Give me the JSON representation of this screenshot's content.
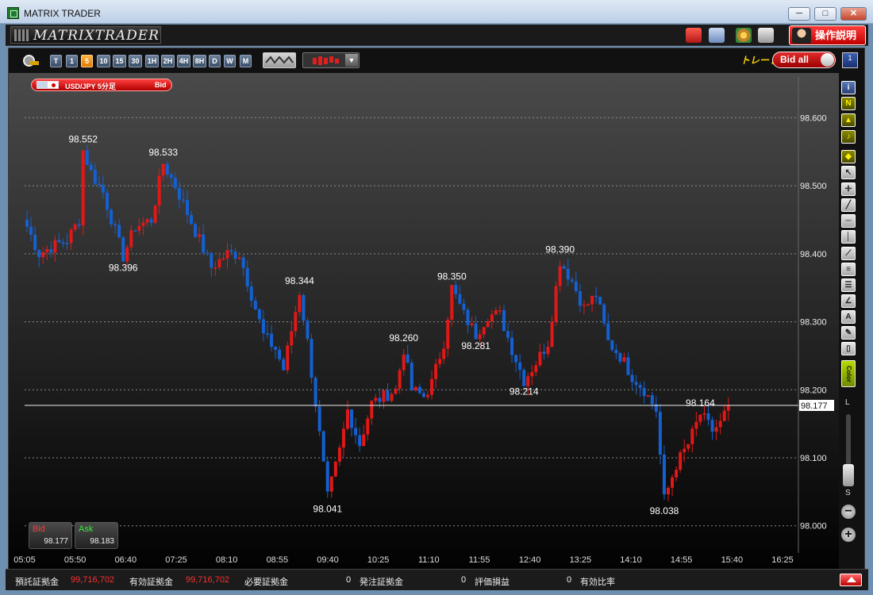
{
  "window": {
    "title": "MATRIX TRADER",
    "controls": {
      "minimize": "─",
      "maximize": "□",
      "close": "✕"
    }
  },
  "header": {
    "logo": "MATRIXTRADER",
    "help_button": "操作説明",
    "icons": [
      "briefcase-icon",
      "save-icon",
      "palette-icon",
      "print-icon"
    ]
  },
  "toolbar": {
    "timeframes": [
      "T",
      "1",
      "5",
      "10",
      "15",
      "30",
      "1H",
      "2H",
      "4H",
      "8H",
      "D",
      "W",
      "M"
    ],
    "active_timeframe": "5",
    "trade_label": "トレード",
    "bid_toggle_label": "Bid all",
    "panel_number": "1"
  },
  "symbol_badge": {
    "symbol": "USD/JPY 5分足",
    "mode": "Bid"
  },
  "quotes": {
    "bid": {
      "label": "Bid",
      "value": "98.177"
    },
    "ask": {
      "label": "Ask",
      "value": "98.183"
    }
  },
  "right_toolbar": {
    "color_tool_label": "Color",
    "zoom_top": "L",
    "zoom_bottom": "S",
    "zoom_out": "−",
    "zoom_in": "+"
  },
  "status_bar": {
    "deposit_label": "預託証拠金",
    "deposit_value": "99,716,702",
    "effective_label": "有効証拠金",
    "effective_value": "99,716,702",
    "required_label": "必要証拠金",
    "required_value": "0",
    "order_label": "発注証拠金",
    "order_value": "0",
    "pl_label": "評価損益",
    "pl_value": "0",
    "ratio_label": "有効比率"
  },
  "colors": {
    "up": "#e01818",
    "down": "#1560d0",
    "grid": "#8a8a8a"
  },
  "chart_data": {
    "type": "candlestick",
    "yticks": [
      98.0,
      98.1,
      98.2,
      98.3,
      98.4,
      98.5,
      98.6
    ],
    "ylim": [
      97.96,
      98.66
    ],
    "x_tick_labels": [
      "05:05",
      "05:50",
      "06:40",
      "07:25",
      "08:10",
      "08:55",
      "09:40",
      "10:25",
      "11:10",
      "11:55",
      "12:40",
      "13:25",
      "14:10",
      "14:55",
      "15:40",
      "16:25"
    ],
    "current_price": "98.177",
    "annotations": [
      {
        "text": "98.552",
        "bar": 14,
        "price": 98.552,
        "pos": "above"
      },
      {
        "text": "98.533",
        "bar": 34,
        "price": 98.533,
        "pos": "above"
      },
      {
        "text": "98.396",
        "bar": 24,
        "price": 98.396,
        "pos": "below"
      },
      {
        "text": "98.344",
        "bar": 68,
        "price": 98.344,
        "pos": "above"
      },
      {
        "text": "98.041",
        "bar": 75,
        "price": 98.041,
        "pos": "below"
      },
      {
        "text": "98.350",
        "bar": 106,
        "price": 98.35,
        "pos": "above"
      },
      {
        "text": "98.260",
        "bar": 94,
        "price": 98.26,
        "pos": "above"
      },
      {
        "text": "98.281",
        "bar": 112,
        "price": 98.281,
        "pos": "below"
      },
      {
        "text": "98.390",
        "bar": 133,
        "price": 98.39,
        "pos": "above"
      },
      {
        "text": "98.214",
        "bar": 124,
        "price": 98.214,
        "pos": "below"
      },
      {
        "text": "98.164",
        "bar": 168,
        "price": 98.164,
        "pos": "above"
      },
      {
        "text": "98.038",
        "bar": 159,
        "price": 98.038,
        "pos": "below"
      }
    ],
    "key_points": [
      [
        0,
        98.44
      ],
      [
        3,
        98.4
      ],
      [
        6,
        98.41
      ],
      [
        10,
        98.42
      ],
      [
        13,
        98.45
      ],
      [
        14,
        98.552
      ],
      [
        16,
        98.52
      ],
      [
        19,
        98.49
      ],
      [
        24,
        98.396
      ],
      [
        27,
        98.44
      ],
      [
        31,
        98.45
      ],
      [
        34,
        98.533
      ],
      [
        37,
        98.5
      ],
      [
        40,
        98.46
      ],
      [
        43,
        98.42
      ],
      [
        46,
        98.38
      ],
      [
        50,
        98.4
      ],
      [
        53,
        98.4
      ],
      [
        56,
        98.34
      ],
      [
        59,
        98.28
      ],
      [
        62,
        98.26
      ],
      [
        64,
        98.23
      ],
      [
        68,
        98.344
      ],
      [
        70,
        98.27
      ],
      [
        72,
        98.18
      ],
      [
        75,
        98.041
      ],
      [
        78,
        98.11
      ],
      [
        80,
        98.17
      ],
      [
        83,
        98.12
      ],
      [
        86,
        98.18
      ],
      [
        89,
        98.19
      ],
      [
        92,
        98.2
      ],
      [
        94,
        98.26
      ],
      [
        96,
        98.2
      ],
      [
        99,
        98.19
      ],
      [
        101,
        98.21
      ],
      [
        104,
        98.27
      ],
      [
        106,
        98.35
      ],
      [
        109,
        98.31
      ],
      [
        112,
        98.281
      ],
      [
        115,
        98.31
      ],
      [
        118,
        98.31
      ],
      [
        121,
        98.26
      ],
      [
        124,
        98.214
      ],
      [
        127,
        98.24
      ],
      [
        130,
        98.27
      ],
      [
        133,
        98.39
      ],
      [
        136,
        98.36
      ],
      [
        139,
        98.32
      ],
      [
        142,
        98.34
      ],
      [
        145,
        98.27
      ],
      [
        148,
        98.25
      ],
      [
        151,
        98.22
      ],
      [
        154,
        98.2
      ],
      [
        157,
        98.17
      ],
      [
        159,
        98.038
      ],
      [
        162,
        98.09
      ],
      [
        165,
        98.12
      ],
      [
        168,
        98.164
      ],
      [
        171,
        98.14
      ],
      [
        173,
        98.15
      ],
      [
        175,
        98.177
      ]
    ]
  }
}
